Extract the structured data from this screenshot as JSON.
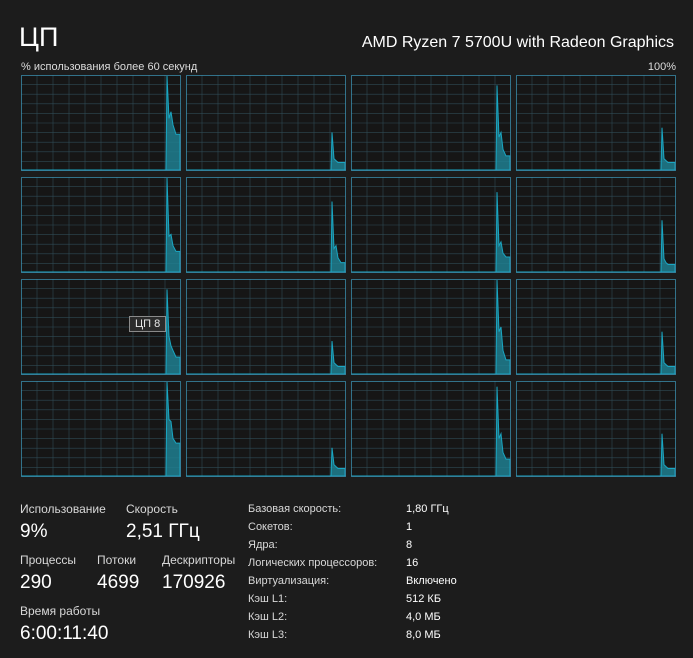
{
  "header": {
    "title": "ЦП",
    "cpu_name": "AMD Ryzen 7 5700U with Radeon Graphics",
    "graph_caption": "% использования более 60 секунд",
    "max_label": "100%"
  },
  "tooltip": "ЦП 8",
  "colors": {
    "background": "#1c1c1c",
    "graph_border": "#3a8aa8",
    "graph_grid": "#2f4a55",
    "graph_line": "#1aa6c2",
    "graph_fill": "#1f7f91"
  },
  "graphs": [
    {
      "peak": 100,
      "tail": [
        55,
        62,
        48,
        38
      ]
    },
    {
      "peak": 40,
      "tail": [
        12,
        10,
        8,
        8
      ]
    },
    {
      "peak": 90,
      "tail": [
        35,
        40,
        22,
        15
      ]
    },
    {
      "peak": 45,
      "tail": [
        12,
        10,
        8,
        8
      ]
    },
    {
      "peak": 100,
      "tail": [
        38,
        40,
        28,
        22
      ]
    },
    {
      "peak": 75,
      "tail": [
        25,
        28,
        15,
        10
      ]
    },
    {
      "peak": 85,
      "tail": [
        28,
        32,
        20,
        16
      ]
    },
    {
      "peak": 55,
      "tail": [
        14,
        10,
        8,
        8
      ]
    },
    {
      "peak": 90,
      "tail": [
        40,
        30,
        25,
        18
      ]
    },
    {
      "peak": 35,
      "tail": [
        12,
        10,
        8,
        8
      ]
    },
    {
      "peak": 100,
      "tail": [
        45,
        50,
        25,
        15
      ]
    },
    {
      "peak": 45,
      "tail": [
        12,
        10,
        8,
        8
      ]
    },
    {
      "peak": 100,
      "tail": [
        60,
        58,
        40,
        35
      ]
    },
    {
      "peak": 30,
      "tail": [
        12,
        10,
        8,
        8
      ]
    },
    {
      "peak": 95,
      "tail": [
        40,
        45,
        25,
        18
      ]
    },
    {
      "peak": 45,
      "tail": [
        12,
        10,
        8,
        8
      ]
    }
  ],
  "stats": {
    "usage": {
      "label": "Использование",
      "value": "9%"
    },
    "speed": {
      "label": "Скорость",
      "value": "2,51 ГГц"
    },
    "processes": {
      "label": "Процессы",
      "value": "290"
    },
    "threads": {
      "label": "Потоки",
      "value": "4699"
    },
    "handles": {
      "label": "Дескрипторы",
      "value": "170926"
    },
    "uptime": {
      "label": "Время работы",
      "value": "6:00:11:40"
    }
  },
  "info": [
    {
      "label": "Базовая скорость:",
      "value": "1,80 ГГц"
    },
    {
      "label": "Сокетов:",
      "value": "1"
    },
    {
      "label": "Ядра:",
      "value": "8"
    },
    {
      "label": "Логических процессоров:",
      "value": "16"
    },
    {
      "label": "Виртуализация:",
      "value": "Включено"
    },
    {
      "label": "Кэш L1:",
      "value": "512 КБ"
    },
    {
      "label": "Кэш L2:",
      "value": "4,0 МБ"
    },
    {
      "label": "Кэш L3:",
      "value": "8,0 МБ"
    }
  ]
}
